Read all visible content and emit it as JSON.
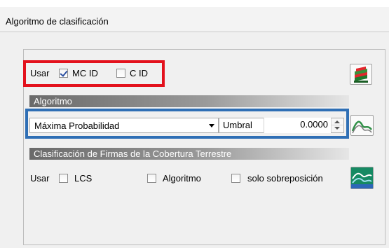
{
  "panel": {
    "title": "Algoritmo de clasificación"
  },
  "class_ids": {
    "usar_label": "Usar",
    "mc_id_label": "MC ID",
    "mc_id_checked": true,
    "c_id_label": "C ID",
    "c_id_checked": false,
    "signature_icon": "layered-signature-icon"
  },
  "algorithm": {
    "section_title": "Algoritmo",
    "selected": "Máxima Probabilidad",
    "threshold_label": "Umbral",
    "threshold_value": "0.0000",
    "threshold_icon": "spectral-threshold-icon"
  },
  "lcs": {
    "section_title": "Clasificación de Firmas de la Cobertura Terrestre",
    "usar_label": "Usar",
    "lcs_label": "LCS",
    "lcs_checked": false,
    "algorithm_label": "Algoritmo",
    "algorithm_checked": false,
    "overlap_label": "solo sobreposición",
    "overlap_checked": false,
    "lcs_icon": "lcs-spectral-icon"
  },
  "colors": {
    "red_highlight": "#e3111c",
    "blue_highlight": "#2f6fb5"
  }
}
